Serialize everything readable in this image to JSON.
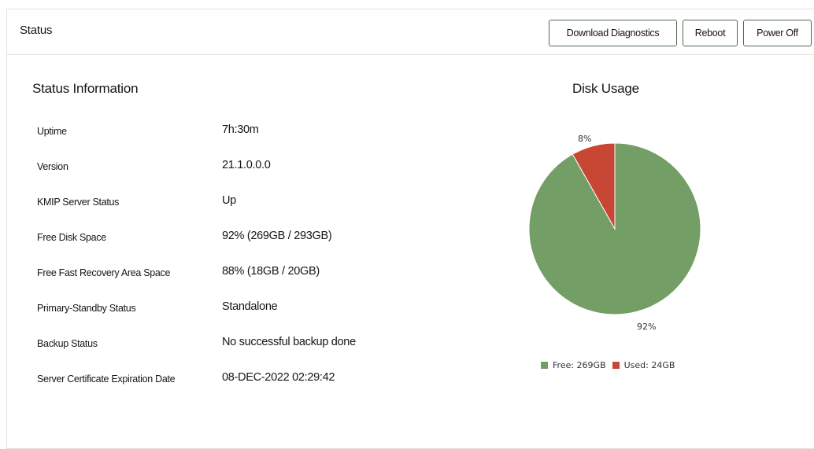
{
  "header": {
    "title": "Status",
    "buttons": {
      "download_diagnostics": "Download Diagnostics",
      "reboot": "Reboot",
      "power_off": "Power Off"
    }
  },
  "status_info": {
    "title": "Status Information",
    "rows": [
      {
        "label": "Uptime",
        "value": "7h:30m"
      },
      {
        "label": "Version",
        "value": "21.1.0.0.0"
      },
      {
        "label": "KMIP Server Status",
        "value": "Up"
      },
      {
        "label": "Free Disk Space",
        "value": "92% (269GB / 293GB)"
      },
      {
        "label": "Free Fast Recovery Area Space",
        "value": "88% (18GB / 20GB)"
      },
      {
        "label": "Primary-Standby Status",
        "value": "Standalone"
      },
      {
        "label": "Backup Status",
        "value": "No successful backup done"
      },
      {
        "label": "Server Certificate Expiration Date",
        "value": "08-DEC-2022 02:29:42"
      }
    ]
  },
  "disk_usage": {
    "title": "Disk Usage",
    "colors": {
      "free": "#739e66",
      "used": "#c74634"
    }
  },
  "chart_data": {
    "type": "pie",
    "title": "Disk Usage",
    "slices": [
      {
        "name": "Free",
        "value": 269,
        "unit": "GB",
        "percent_label": "92%",
        "legend": "Free: 269GB",
        "color": "#739e66"
      },
      {
        "name": "Used",
        "value": 24,
        "unit": "GB",
        "percent_label": "8%",
        "legend": "Used: 24GB",
        "color": "#c74634"
      }
    ],
    "legend_position": "bottom"
  }
}
